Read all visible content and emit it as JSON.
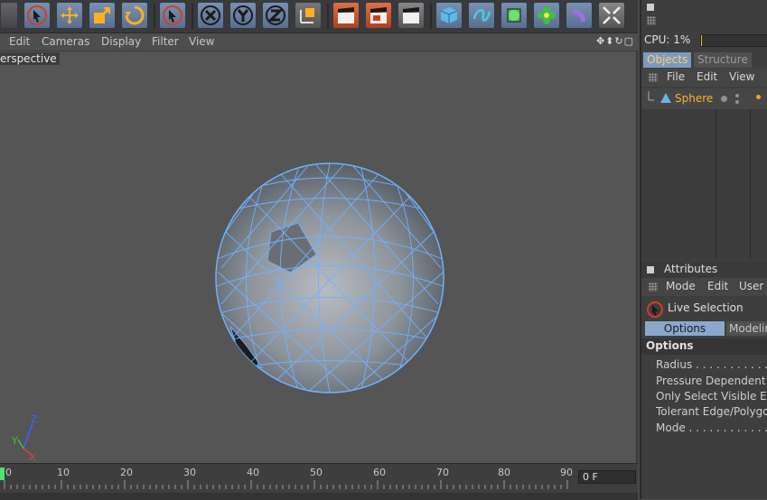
{
  "viewport": {
    "menu": [
      "Edit",
      "Cameras",
      "Display",
      "Filter",
      "View"
    ],
    "camera_label": "erspective",
    "nav_icons": "✥⬍↻▢",
    "axis": {
      "x": "X",
      "y": "Y",
      "z": "Z"
    }
  },
  "timeline": {
    "ticks": [
      "0",
      "10",
      "20",
      "30",
      "40",
      "50",
      "60",
      "70",
      "80",
      "90"
    ],
    "frame_value": "0 F"
  },
  "right_panel": {
    "cpu_label": "CPU: 1%",
    "tabs": [
      {
        "label": "Objects",
        "active": true
      },
      {
        "label": "Structure",
        "active": false
      }
    ],
    "objects_menu": [
      "File",
      "Edit",
      "View"
    ],
    "object": {
      "name": "Sphere",
      "color": "#ffb030"
    },
    "attributes_title": "Attributes",
    "attributes_menu": [
      "Mode",
      "Edit",
      "User"
    ],
    "tool_name": "Live Selection",
    "attr_tabs": [
      {
        "label": "Options",
        "active": true
      },
      {
        "label": "Modelin",
        "active": false
      }
    ],
    "section_title": "Options",
    "attr_rows": [
      "Radius . . . . . . . . . . . . . . . .",
      "Pressure Dependent R",
      "Only Select Visible Ele",
      "Tolerant Edge/Polygo",
      "Mode . . . . . . . . . . . . . . . . ."
    ]
  },
  "colors": {
    "accent": "#4a90d9",
    "active_tab": "#7c9ac0",
    "object_orange": "#ffb030"
  }
}
